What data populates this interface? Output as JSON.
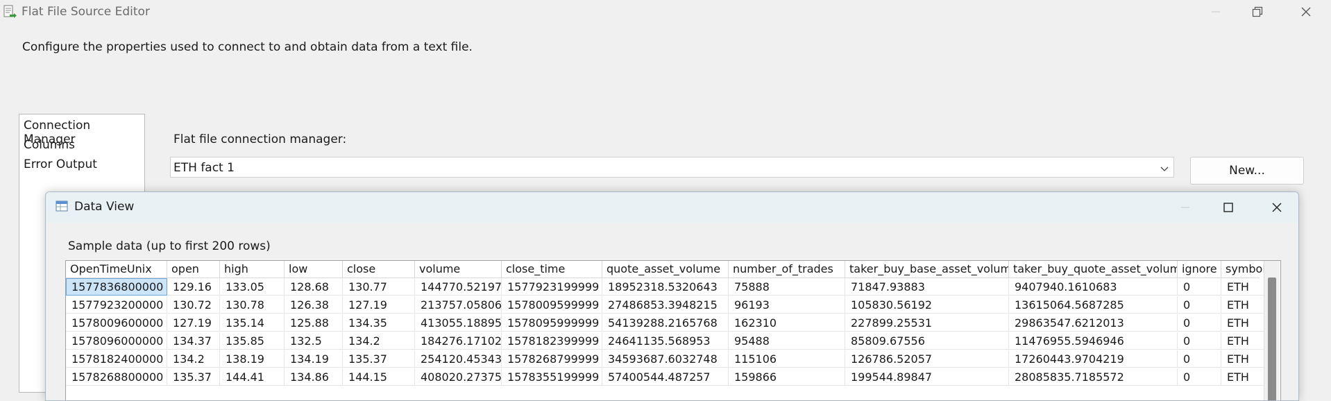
{
  "window": {
    "title": "Flat File Source Editor"
  },
  "description": "Configure the properties used to connect to and obtain data from a text file.",
  "nav": {
    "items": [
      {
        "label": "Connection Manager"
      },
      {
        "label": "Columns"
      },
      {
        "label": "Error Output"
      }
    ]
  },
  "connection": {
    "label": "Flat file connection manager:",
    "value": "ETH fact 1",
    "new_button": "New..."
  },
  "data_view": {
    "title": "Data View",
    "sample_label": "Sample data (up to first 200 rows)",
    "columns": [
      "OpenTimeUnix",
      "open",
      "high",
      "low",
      "close",
      "volume",
      "close_time",
      "quote_asset_volume",
      "number_of_trades",
      "taker_buy_base_asset_volume",
      "taker_buy_quote_asset_volume",
      "ignore",
      "symbol"
    ],
    "rows": [
      [
        "1577836800000",
        "129.16",
        "133.05",
        "128.68",
        "130.77",
        "144770.52197",
        "1577923199999",
        "18952318.5320643",
        "75888",
        "71847.93883",
        "9407940.1610683",
        "0",
        "ETH"
      ],
      [
        "1577923200000",
        "130.72",
        "130.78",
        "126.38",
        "127.19",
        "213757.05806",
        "1578009599999",
        "27486853.3948215",
        "96193",
        "105830.56192",
        "13615064.5687285",
        "0",
        "ETH"
      ],
      [
        "1578009600000",
        "127.19",
        "135.14",
        "125.88",
        "134.35",
        "413055.18895",
        "1578095999999",
        "54139288.2165768",
        "162310",
        "227899.25531",
        "29863547.6212013",
        "0",
        "ETH"
      ],
      [
        "1578096000000",
        "134.37",
        "135.85",
        "132.5",
        "134.2",
        "184276.17102",
        "1578182399999",
        "24641135.568953",
        "95488",
        "85809.67556",
        "11476955.5946946",
        "0",
        "ETH"
      ],
      [
        "1578182400000",
        "134.2",
        "138.19",
        "134.19",
        "135.37",
        "254120.45343",
        "1578268799999",
        "34593687.6032748",
        "115106",
        "126786.52057",
        "17260443.9704219",
        "0",
        "ETH"
      ],
      [
        "1578268800000",
        "135.37",
        "144.41",
        "134.86",
        "144.15",
        "408020.27375",
        "1578355199999",
        "57400544.487257",
        "159866",
        "199544.89847",
        "28085835.7185572",
        "0",
        "ETH"
      ]
    ]
  }
}
